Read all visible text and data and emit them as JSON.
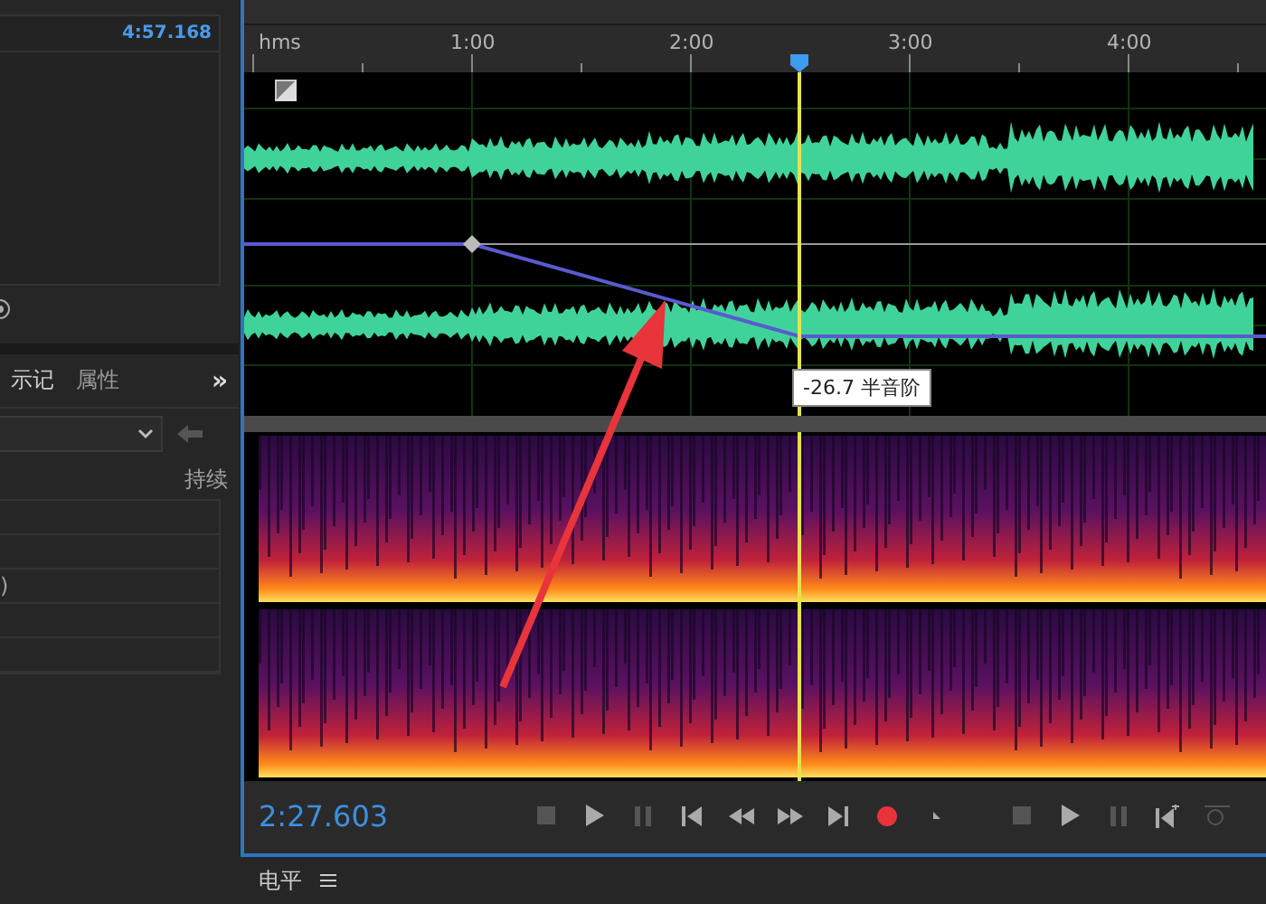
{
  "files_panel": {
    "rows": [
      {
        "duration": "4:57.168"
      }
    ]
  },
  "markers_panel": {
    "tabs": [
      {
        "label": "示记",
        "selected": true
      },
      {
        "label": "属性",
        "selected": false
      }
    ],
    "more": "»",
    "column": "持续",
    "row_text": ")"
  },
  "editor": {
    "ruler": [
      "hms",
      "1:00",
      "2:00",
      "3:00",
      "4:00"
    ],
    "tooltip": "-26.7 半音阶",
    "timecode": "2:27.603"
  },
  "levels_panel": {
    "title": "电平"
  }
}
